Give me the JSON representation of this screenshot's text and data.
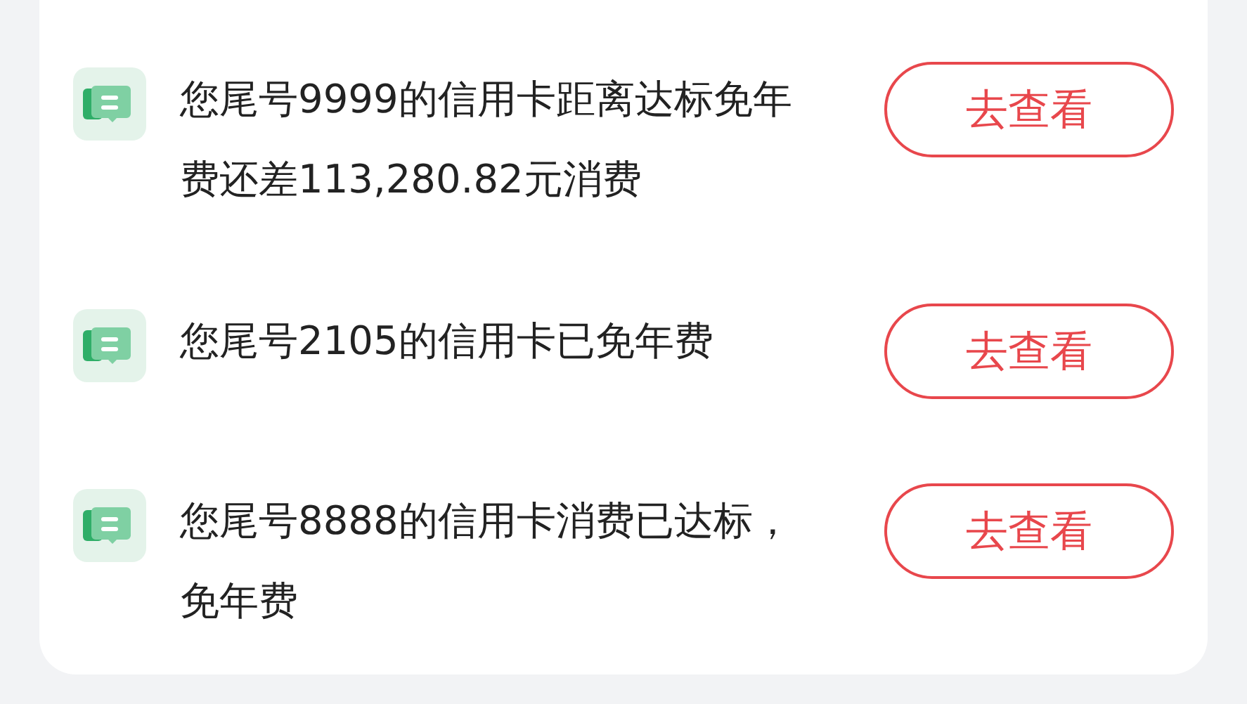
{
  "notices": [
    {
      "text": "您尾号9999的信用卡距离达标免年费还差113,280.82元消费",
      "button": "去查看"
    },
    {
      "text": "您尾号2105的信用卡已免年费",
      "button": "去查看"
    },
    {
      "text": "您尾号8888的信用卡消费已达标，免年费",
      "button": "去查看"
    }
  ]
}
